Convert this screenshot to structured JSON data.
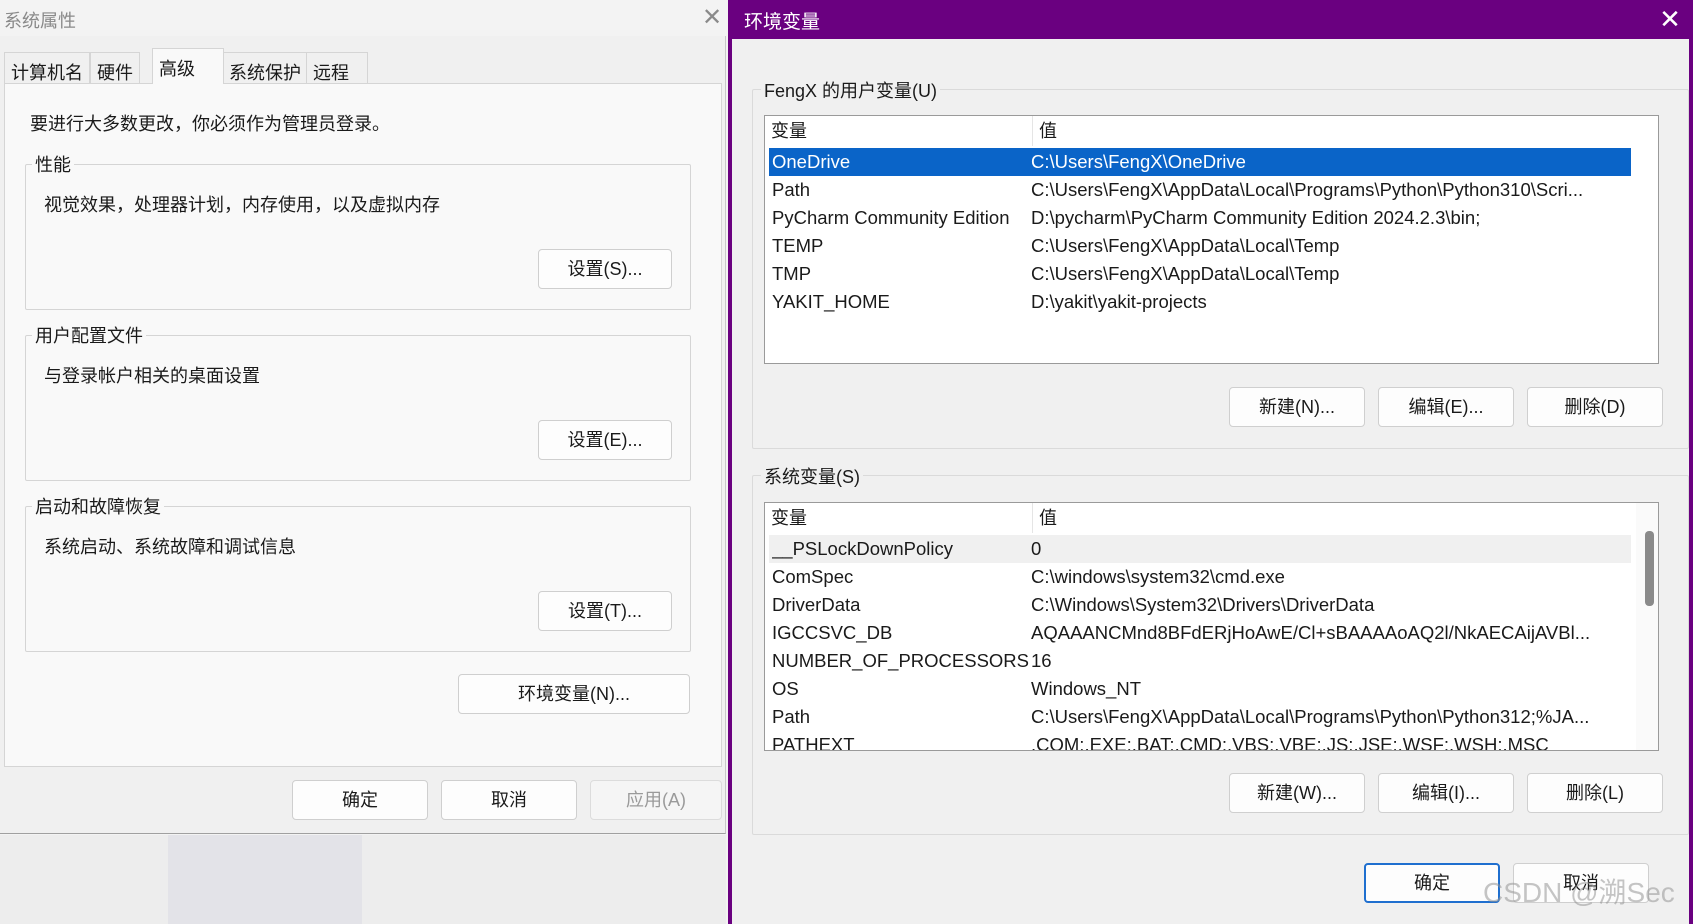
{
  "system_properties": {
    "title": "系统属性",
    "tabs": [
      "计算机名",
      "硬件",
      "高级",
      "系统保护",
      "远程"
    ],
    "active_tab": "高级",
    "notice": "要进行大多数更改，你必须作为管理员登录。",
    "groups": [
      {
        "label": "性能",
        "desc": "视觉效果，处理器计划，内存使用，以及虚拟内存",
        "button": "设置(S)..."
      },
      {
        "label": "用户配置文件",
        "desc": "与登录帐户相关的桌面设置",
        "button": "设置(E)..."
      },
      {
        "label": "启动和故障恢复",
        "desc": "系统启动、系统故障和调试信息",
        "button": "设置(T)..."
      }
    ],
    "env_button": "环境变量(N)...",
    "footer": {
      "ok": "确定",
      "cancel": "取消",
      "apply": "应用(A)"
    }
  },
  "env_vars": {
    "title": "环境变量",
    "user": {
      "label": "FengX 的用户变量(U)",
      "columns": [
        "变量",
        "值"
      ],
      "rows": [
        {
          "name": "OneDrive",
          "value": "C:\\Users\\FengX\\OneDrive"
        },
        {
          "name": "Path",
          "value": "C:\\Users\\FengX\\AppData\\Local\\Programs\\Python\\Python310\\Scri..."
        },
        {
          "name": "PyCharm Community Edition",
          "value": "D:\\pycharm\\PyCharm Community Edition 2024.2.3\\bin;"
        },
        {
          "name": "TEMP",
          "value": "C:\\Users\\FengX\\AppData\\Local\\Temp"
        },
        {
          "name": "TMP",
          "value": "C:\\Users\\FengX\\AppData\\Local\\Temp"
        },
        {
          "name": "YAKIT_HOME",
          "value": "D:\\yakit\\yakit-projects"
        }
      ],
      "selected": "OneDrive",
      "buttons": {
        "new": "新建(N)...",
        "edit": "编辑(E)...",
        "delete": "删除(D)"
      }
    },
    "system": {
      "label": "系统变量(S)",
      "columns": [
        "变量",
        "值"
      ],
      "rows": [
        {
          "name": "__PSLockDownPolicy",
          "value": "0"
        },
        {
          "name": "ComSpec",
          "value": "C:\\windows\\system32\\cmd.exe"
        },
        {
          "name": "DriverData",
          "value": "C:\\Windows\\System32\\Drivers\\DriverData"
        },
        {
          "name": "IGCCSVC_DB",
          "value": "AQAAANCMnd8BFdERjHoAwE/Cl+sBAAAAoAQ2l/NkAECAijAVBl..."
        },
        {
          "name": "NUMBER_OF_PROCESSORS",
          "value": "16"
        },
        {
          "name": "OS",
          "value": "Windows_NT"
        },
        {
          "name": "Path",
          "value": "C:\\Users\\FengX\\AppData\\Local\\Programs\\Python\\Python312;%JA..."
        },
        {
          "name": "PATHEXT",
          "value": ".COM;.EXE;.BAT;.CMD;.VBS;.VBE;.JS;.JSE;.WSF;.WSH;.MSC"
        }
      ],
      "highlighted": "__PSLockDownPolicy",
      "buttons": {
        "new": "新建(W)...",
        "edit": "编辑(I)...",
        "delete": "删除(L)"
      }
    },
    "footer": {
      "ok": "确定",
      "cancel": "取消"
    }
  },
  "watermark": "CSDN @溯Sec",
  "colors": {
    "accent_purple": "#6a0080",
    "selection_blue": "#0a64c8",
    "primary_border": "#1f6fcf"
  }
}
